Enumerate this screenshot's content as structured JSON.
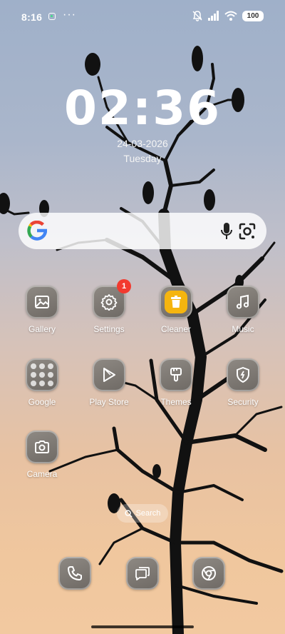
{
  "status_bar": {
    "time": "8:16",
    "more": "···",
    "battery": "100",
    "icons": [
      "notification-app-icon",
      "mute-icon",
      "signal-icon",
      "wifi-icon",
      "battery-icon"
    ]
  },
  "clock": {
    "time": "02:36",
    "date": "24-03-2026",
    "day": "Tuesday"
  },
  "search": {
    "icons": [
      "google-logo-icon",
      "microphone-icon",
      "lens-icon"
    ]
  },
  "apps": [
    {
      "label": "Gallery",
      "icon": "gallery-icon"
    },
    {
      "label": "Settings",
      "icon": "gear-icon",
      "badge": "1"
    },
    {
      "label": "Cleaner",
      "icon": "trash-icon"
    },
    {
      "label": "Music",
      "icon": "music-note-icon"
    },
    {
      "label": "Google",
      "icon": "app-folder-icon"
    },
    {
      "label": "Play Store",
      "icon": "play-store-icon"
    },
    {
      "label": "Themes",
      "icon": "brush-icon"
    },
    {
      "label": "Security",
      "icon": "shield-icon"
    },
    {
      "label": "Camera",
      "icon": "camera-icon"
    }
  ],
  "search_pill": {
    "label": "Search"
  },
  "dock": [
    {
      "icon": "phone-icon"
    },
    {
      "icon": "messages-icon"
    },
    {
      "icon": "chrome-icon"
    }
  ],
  "colors": {
    "badge": "#f23a2f",
    "cleaner_accent": "#f5b50f",
    "icon_tile": "#7d7873"
  }
}
